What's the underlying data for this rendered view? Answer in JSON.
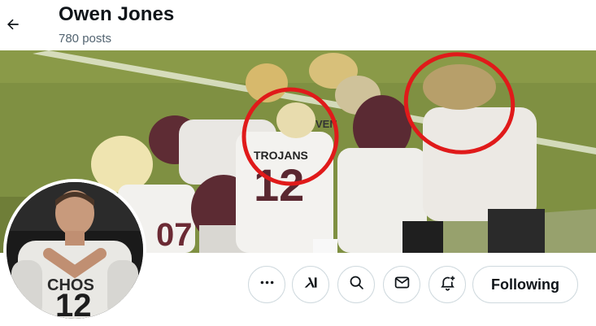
{
  "header": {
    "display_name": "Owen Jones",
    "post_count": "780 posts"
  },
  "banner": {
    "jersey_text": "TROJANS",
    "jersey_number": "12",
    "sleeve_text": "VEN",
    "annotation_color": "#e01a1a"
  },
  "avatar": {
    "jersey_text": "CHOS",
    "jersey_number": "12"
  },
  "actions": {
    "more_icon": "more-icon",
    "grok_icon": "grok-icon",
    "search_icon": "search-icon",
    "message_icon": "message-icon",
    "notify_icon": "notify-bell-icon",
    "follow_label": "Following"
  }
}
